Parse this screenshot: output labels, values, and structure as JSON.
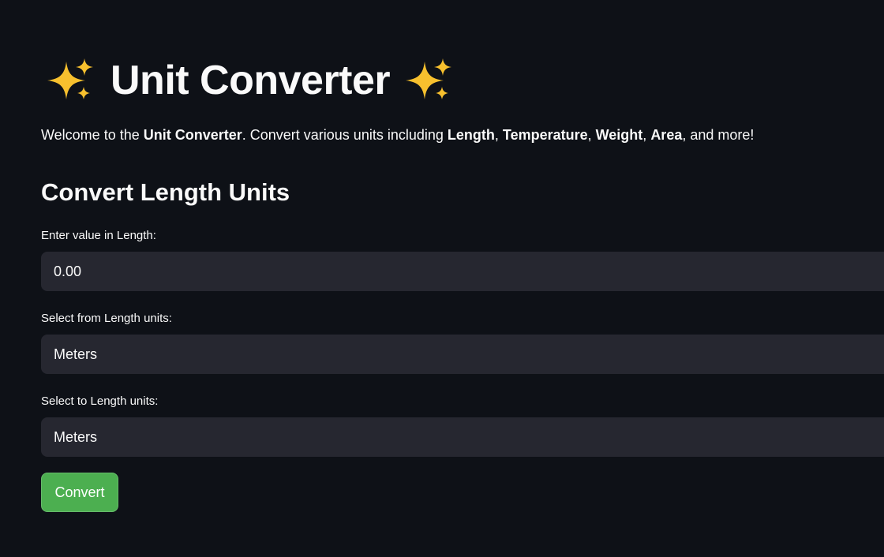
{
  "header": {
    "title": "Unit Converter",
    "leading_icon": "sparkles-icon",
    "trailing_icon": "sparkles-icon",
    "icon_color": "#f7c02e"
  },
  "intro": {
    "prefix": "Welcome to the ",
    "app_name": "Unit Converter",
    "middle": ". Convert various units including ",
    "unit_length": "Length",
    "sep1": ", ",
    "unit_temperature": "Temperature",
    "sep2": ", ",
    "unit_weight": "Weight",
    "sep3": ", ",
    "unit_area": "Area",
    "suffix": ", and more!"
  },
  "section": {
    "title": "Convert Length Units"
  },
  "value_input": {
    "label": "Enter value in Length:",
    "value": "0.00"
  },
  "from_select": {
    "label": "Select from Length units:",
    "selected": "Meters"
  },
  "to_select": {
    "label": "Select to Length units:",
    "selected": "Meters"
  },
  "convert_button": {
    "label": "Convert",
    "color": "#4caf50"
  },
  "theme": {
    "background": "#0e1117",
    "field_background": "#262730",
    "text": "#fafafa"
  }
}
